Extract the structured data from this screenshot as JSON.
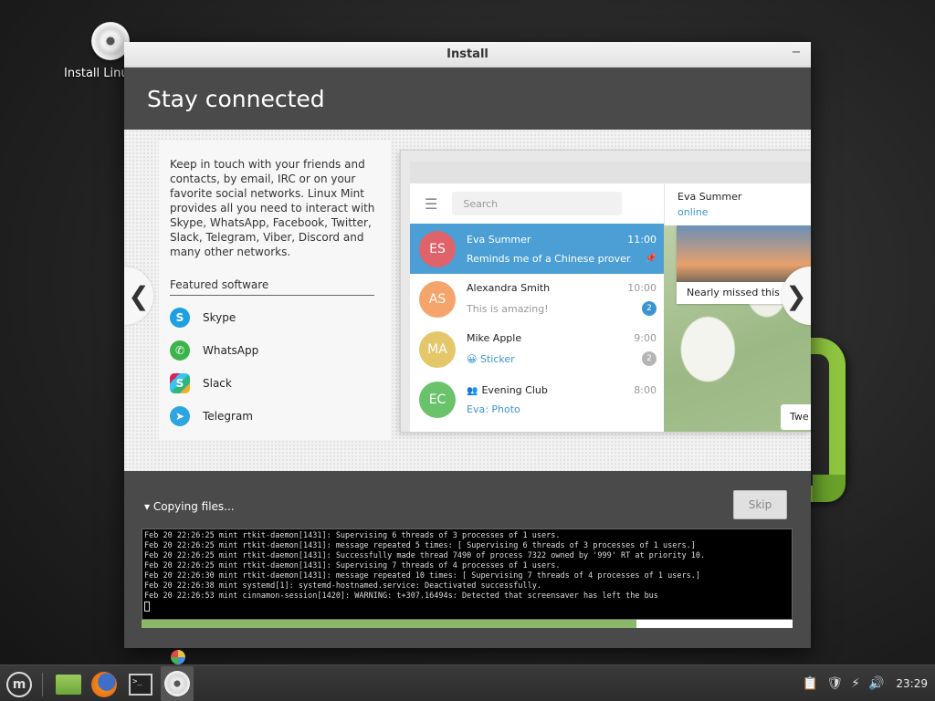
{
  "desktop": {
    "icon_label": "Install Linux Mint"
  },
  "window": {
    "title": "Install",
    "minimize_glyph": "−"
  },
  "slide": {
    "heading": "Stay connected",
    "description": "Keep in touch with your friends and contacts, by email, IRC or on your favorite social networks. Linux Mint provides all you need to interact with Skype, WhatsApp, Facebook, Twitter, Slack, Telegram, Viber, Discord and many other networks.",
    "featured_title": "Featured software",
    "apps": [
      {
        "name": "Skype",
        "glyph": "S"
      },
      {
        "name": "WhatsApp",
        "glyph": "✆"
      },
      {
        "name": "Slack",
        "glyph": "S"
      },
      {
        "name": "Telegram",
        "glyph": "➤"
      }
    ],
    "prev_glyph": "❮",
    "next_glyph": "❯"
  },
  "telegram": {
    "search_placeholder": "Search",
    "menu_glyph": "☰",
    "chats": [
      {
        "initials": "ES",
        "name": "Eva Summer",
        "time": "11:00",
        "message": "Reminds me of a Chinese prover...",
        "color": "#e0626a",
        "pinned": true
      },
      {
        "initials": "AS",
        "name": "Alexandra Smith",
        "time": "10:00",
        "message": "This is amazing!",
        "badge": "2",
        "badge_color": "#3a95d3",
        "color": "#f5a46b"
      },
      {
        "initials": "MA",
        "name": "Mike Apple",
        "time": "9:00",
        "message": "😀 Sticker",
        "badge": "2",
        "badge_color": "#b5b5b5",
        "color": "#e5c76b"
      },
      {
        "initials": "EC",
        "name": "Evening Club",
        "time": "8:00",
        "message": "Eva: Photo",
        "color": "#6ac26b",
        "group": true
      }
    ],
    "pin_glyph": "📌",
    "group_glyph": "👥",
    "contact_name": "Eva Summer",
    "contact_status": "online",
    "photo_caption": "Nearly missed this s",
    "bubble_text": "Twe"
  },
  "progress": {
    "toggle_label": "▾ Copying files...",
    "skip_label": "Skip",
    "fraction": 0.76,
    "log_lines": [
      "Feb 20 22:26:25 mint rtkit-daemon[1431]: Supervising 6 threads of 3 processes of 1 users.",
      "Feb 20 22:26:25 mint rtkit-daemon[1431]: message repeated 5 times: [ Supervising 6 threads of 3 processes of 1 users.]",
      "Feb 20 22:26:25 mint rtkit-daemon[1431]: Successfully made thread 7490 of process 7322 owned by '999' RT at priority 10.",
      "Feb 20 22:26:25 mint rtkit-daemon[1431]: Supervising 7 threads of 4 processes of 1 users.",
      "Feb 20 22:26:30 mint rtkit-daemon[1431]: message repeated 10 times: [ Supervising 7 threads of 4 processes of 1 users.]",
      "Feb 20 22:26:38 mint systemd[1]: systemd-hostnamed.service: Deactivated successfully.",
      "Feb 20 22:26:53 mint cinnamon-session[1420]: WARNING: t+307.16494s: Detected that screensaver has left the bus"
    ]
  },
  "taskbar": {
    "menu_glyph": "m",
    "terminal_glyph": ">_",
    "tray_icons": [
      "clipboard-icon",
      "shield-icon",
      "network-icon",
      "volume-icon"
    ],
    "tray_glyphs": [
      "📋",
      "🛡",
      "⚡",
      "🔊"
    ],
    "clock": "23:29"
  }
}
